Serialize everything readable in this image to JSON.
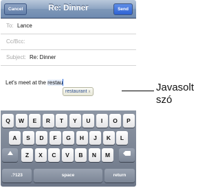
{
  "navbar": {
    "title": "Re: Dinner",
    "cancel_label": "Cancel",
    "send_label": "Send"
  },
  "fields": {
    "to_label": "To:",
    "to_value": "Lance",
    "cc_label": "Cc/Bcc:",
    "subject_label": "Subject:",
    "subject_value": "Re: Dinner"
  },
  "body": {
    "text_before": "Let's meet at the ",
    "typed_word": "restau",
    "suggestion": "restaurant",
    "suggestion_dismiss": "x"
  },
  "keyboard": {
    "row1": [
      "Q",
      "W",
      "E",
      "R",
      "T",
      "Y",
      "U",
      "I",
      "O",
      "P"
    ],
    "row2": [
      "A",
      "S",
      "D",
      "F",
      "G",
      "H",
      "J",
      "K",
      "L"
    ],
    "row3": [
      "Z",
      "X",
      "C",
      "V",
      "B",
      "N",
      "M"
    ],
    "numbers_label": ".?123",
    "space_label": "space",
    "return_label": "return",
    "shift_icon": "shift-arrow-icon",
    "delete_icon": "backspace-icon"
  },
  "callout": {
    "line1": "Javasolt",
    "line2": "szó"
  }
}
